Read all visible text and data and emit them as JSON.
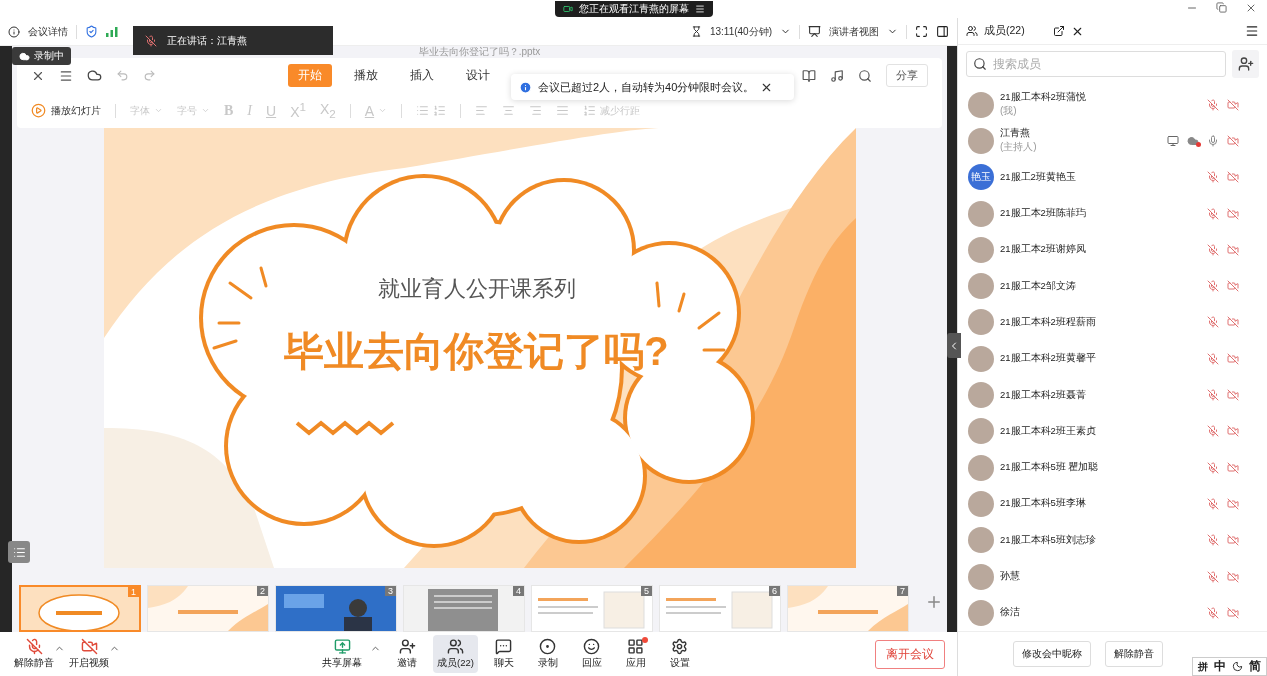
{
  "top_banner": {
    "text": "您正在观看江青燕的屏幕"
  },
  "meeting_bar": {
    "details": "会议详情",
    "speaking": "正在讲话：江青燕",
    "recording_badge": "录制中",
    "timer": "13:11(40分钟)",
    "view_mode": "演讲者视图"
  },
  "document": {
    "filename": "毕业去向你登记了吗？.pptx",
    "tabs": [
      {
        "label": "开始",
        "selected": true
      },
      {
        "label": "播放",
        "selected": false
      },
      {
        "label": "插入",
        "selected": false
      },
      {
        "label": "设计",
        "selected": false
      }
    ],
    "share": "分享",
    "play": "播放幻灯片",
    "format_disabled": true,
    "format_tools": [
      {
        "label": "字体",
        "kind": "dropdown"
      },
      {
        "label": "字号",
        "kind": "dropdown"
      },
      {
        "label": "B",
        "kind": "bold"
      },
      {
        "label": "I",
        "kind": "italic"
      },
      {
        "label": "U",
        "kind": "underline"
      },
      {
        "label": "X$^{1}$",
        "kind": "plain"
      },
      {
        "label": "X$_{2}$",
        "kind": "plain"
      },
      {
        "label": "A",
        "kind": "color"
      },
      {
        "label": "减少行距",
        "kind": "spacing"
      }
    ]
  },
  "notice": {
    "text": "会议已超过2人，自动转为40分钟限时会议。"
  },
  "slide": {
    "subtitle": "就业育人公开课系列",
    "title": "毕业去向你登记了吗?"
  },
  "thumbnails": [
    {
      "number": "1",
      "selected": true,
      "kind": "title"
    },
    {
      "number": "2",
      "selected": false,
      "kind": "heading"
    },
    {
      "number": "3",
      "selected": false,
      "kind": "video"
    },
    {
      "number": "4",
      "selected": false,
      "kind": "document"
    },
    {
      "number": "5",
      "selected": false,
      "kind": "content"
    },
    {
      "number": "6",
      "selected": false,
      "kind": "content"
    },
    {
      "number": "7",
      "selected": false,
      "kind": "heading"
    }
  ],
  "audio_video": [
    {
      "label": "解除静音",
      "kind": "mic"
    },
    {
      "label": "开启视频",
      "kind": "video"
    }
  ],
  "controls": [
    {
      "label": "共享屏幕",
      "kind": "share",
      "selected": false,
      "caret": true,
      "badge": false
    },
    {
      "label": "邀请",
      "kind": "invite",
      "selected": false,
      "caret": false,
      "badge": false
    },
    {
      "label": "成员(22)",
      "kind": "members",
      "selected": true,
      "caret": false,
      "badge": false
    },
    {
      "label": "聊天",
      "kind": "chat",
      "selected": false,
      "caret": false,
      "badge": false
    },
    {
      "label": "录制",
      "kind": "record",
      "selected": false,
      "caret": false,
      "badge": false
    },
    {
      "label": "回应",
      "kind": "react",
      "selected": false,
      "caret": false,
      "badge": false
    },
    {
      "label": "应用",
      "kind": "apps",
      "selected": false,
      "caret": false,
      "badge": true
    },
    {
      "label": "设置",
      "kind": "settings",
      "selected": false,
      "caret": false,
      "badge": false
    }
  ],
  "leave_button": "离开会议",
  "members_panel": {
    "title": "成员(22)",
    "search_placeholder": "搜索成员",
    "members": [
      {
        "name": "21服工本科2班蒲悦",
        "role": "(我)",
        "muted": true,
        "sharing": false,
        "recording": false
      },
      {
        "name": "江青燕",
        "role": "(主持人)",
        "muted": false,
        "sharing": true,
        "recording": true
      },
      {
        "name": "21服工2班黄艳玉",
        "avatar_text": "艳玉",
        "muted": true,
        "sharing": false,
        "recording": false
      },
      {
        "name": "21服工本2班陈菲玙",
        "muted": true,
        "sharing": false,
        "recording": false
      },
      {
        "name": "21服工本2班谢婷凤",
        "muted": true,
        "sharing": false,
        "recording": false
      },
      {
        "name": "21服工本2邹文涛",
        "muted": true,
        "sharing": false,
        "recording": false
      },
      {
        "name": "21服工本科2班程薪雨",
        "muted": true,
        "sharing": false,
        "recording": false
      },
      {
        "name": "21服工本科2班黄馨平",
        "muted": true,
        "sharing": false,
        "recording": false
      },
      {
        "name": "21服工本科2班聂菁",
        "muted": true,
        "sharing": false,
        "recording": false
      },
      {
        "name": "21服工本科2班王素贞",
        "muted": true,
        "sharing": false,
        "recording": false
      },
      {
        "name": "21服工本科5班 瞿加聪",
        "muted": true,
        "sharing": false,
        "recording": false
      },
      {
        "name": "21服工本科5班李琳",
        "muted": true,
        "sharing": false,
        "recording": false
      },
      {
        "name": "21服工本科5班刘志珍",
        "muted": true,
        "sharing": false,
        "recording": false
      },
      {
        "name": "孙慧",
        "muted": true,
        "sharing": false,
        "recording": false
      },
      {
        "name": "徐洁",
        "muted": true,
        "sharing": false,
        "recording": false
      }
    ],
    "buttons": [
      "修改会中昵称",
      "解除静音"
    ]
  },
  "ime": {
    "mode": "拼",
    "language": "中",
    "script": "简"
  }
}
